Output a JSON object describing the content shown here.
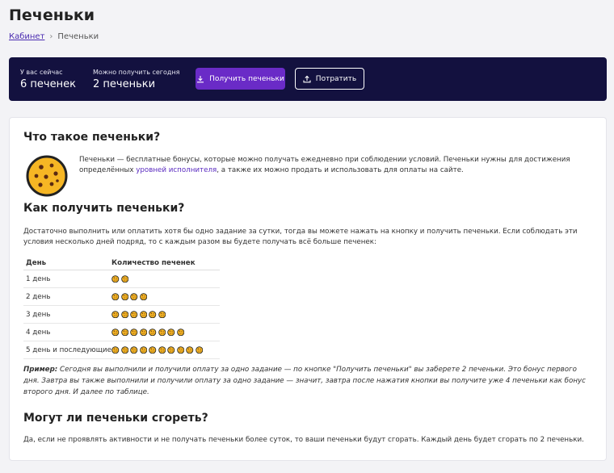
{
  "page": {
    "title": "Печеньки",
    "breadcrumb": {
      "home": "Кабинет",
      "current": "Печеньки"
    }
  },
  "balance": {
    "current_label": "У вас сейчас",
    "current_value": "6 печенек",
    "today_label": "Можно получить сегодня",
    "today_value": "2 печеньки",
    "get_button": "Получить печеньки",
    "spend_button": "Потратить"
  },
  "about": {
    "heading": "Что такое печеньки?",
    "text_before_link": "Печеньки — бесплатные бонусы, которые можно получать ежедневно при соблюдении условий. Печеньки нужны для достижения определённых ",
    "link": "уровней исполнителя",
    "text_after_link": ", а также их можно продать и использовать для оплаты на сайте."
  },
  "how": {
    "heading": "Как получить печеньки?",
    "text": "Достаточно выполнить или оплатить хотя бы одно задание за сутки, тогда вы можете нажать на кнопку и получить печеньки. Если соблюдать эти условия несколько дней подряд, то с каждым разом вы будете получать всё больше печенек:"
  },
  "table": {
    "col_day": "День",
    "col_count": "Количество печенек",
    "rows": [
      {
        "day": "1 день",
        "count": 2
      },
      {
        "day": "2 день",
        "count": 4
      },
      {
        "day": "3 день",
        "count": 6
      },
      {
        "day": "4 день",
        "count": 8
      },
      {
        "day": "5 день и последующие",
        "count": 10
      }
    ]
  },
  "example": {
    "label": "Пример:",
    "text": " Сегодня вы выполнили и получили оплату за одно задание — по кнопке \"Получить печеньки\" вы заберете 2 печеньки. Это бонус первого дня. Завтра вы также выполнили и получили оплату за одно задание — значит, завтра после нажатия кнопки вы получите уже 4 печеньки как бонус второго дня. И далее по таблице."
  },
  "burn": {
    "heading": "Могут ли печеньки сгореть?",
    "text": "Да, если не проявлять активности и не получать печеньки более суток, то ваши печеньки будут сгорать. Каждый день будет сгорать по 2 печеньки."
  },
  "colors": {
    "bar_bg": "#13113f",
    "accent": "#6a2bc7",
    "cookie_fill": "#f6b624",
    "cookie_outline": "#222222"
  },
  "icons": {
    "download": "download-icon",
    "upload": "upload-icon",
    "cookie": "cookie-icon"
  }
}
